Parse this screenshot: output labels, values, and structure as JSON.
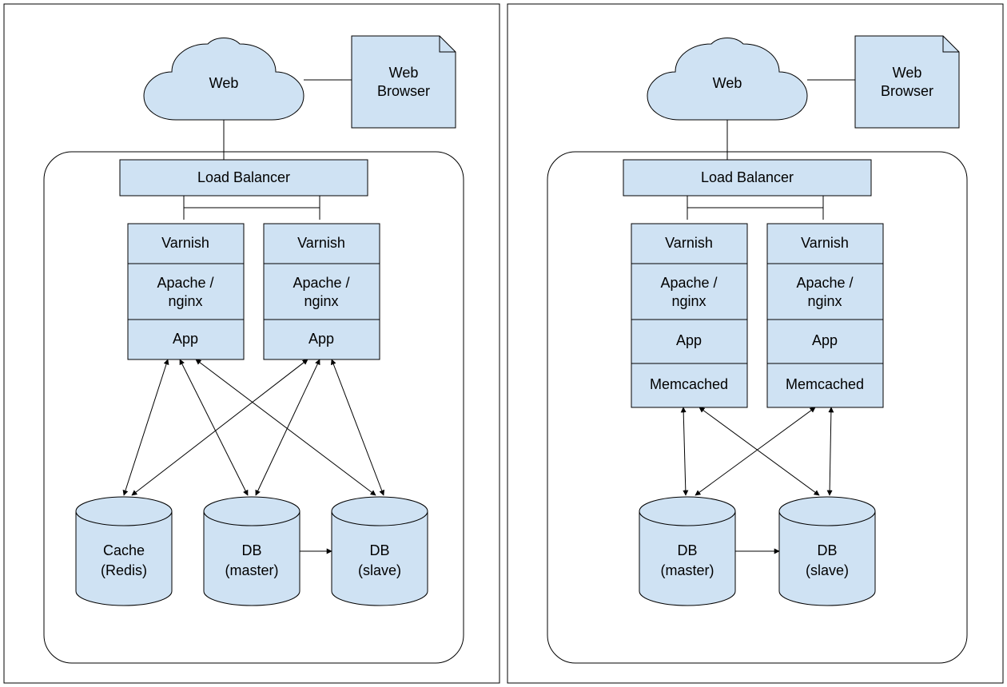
{
  "common": {
    "web": "Web",
    "browser1": "Web",
    "browser2": "Browser",
    "loadBalancer": "Load Balancer",
    "varnish": "Varnish",
    "apache1": "Apache /",
    "apache2": "nginx",
    "app": "App",
    "memcached": "Memcached",
    "cache1": "Cache",
    "cache2": "(Redis)",
    "dbMaster1": "DB",
    "dbMaster2": "(master)",
    "dbSlave1": "DB",
    "dbSlave2": "(slave)"
  }
}
